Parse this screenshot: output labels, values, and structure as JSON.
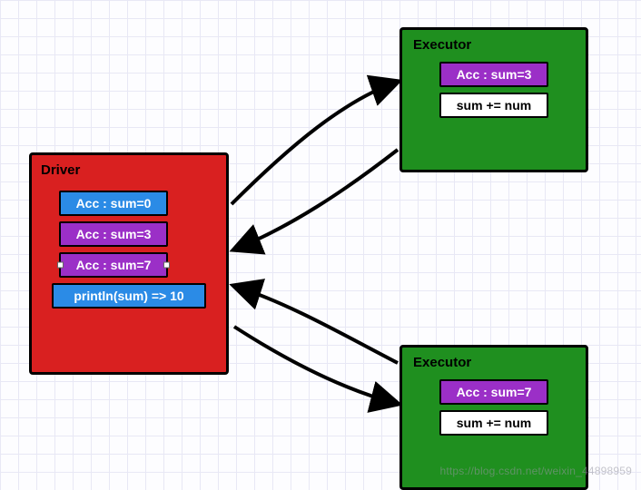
{
  "driver": {
    "title": "Driver",
    "items": [
      {
        "label": "Acc : sum=0",
        "color": "blue"
      },
      {
        "label": "Acc : sum=3",
        "color": "purple"
      },
      {
        "label": "Acc : sum=7",
        "color": "purple"
      },
      {
        "label": "println(sum) => 10",
        "color": "blue"
      }
    ]
  },
  "executors": [
    {
      "title": "Executor",
      "acc": "Acc : sum=3",
      "code": "sum += num"
    },
    {
      "title": "Executor",
      "acc": "Acc : sum=7",
      "code": "sum += num"
    }
  ],
  "watermark": "https://blog.csdn.net/weixin_44898959",
  "colors": {
    "driver_bg": "#d92020",
    "executor_bg": "#1f8f1f",
    "chip_blue": "#2b8be6",
    "chip_purple": "#9b2fc7"
  }
}
